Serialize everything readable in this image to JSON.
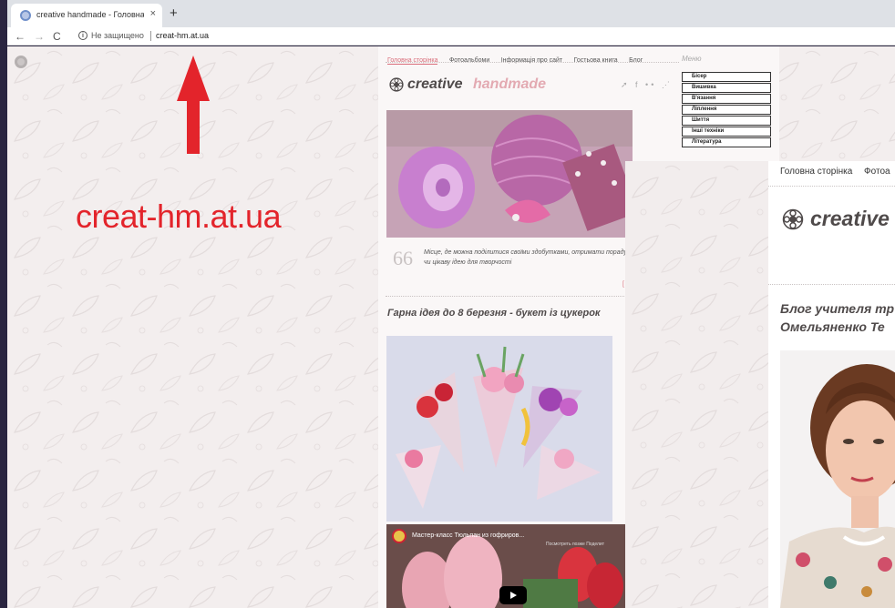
{
  "browser": {
    "tab_title": "creative handmade - Головна сторінка",
    "tab_close": "×",
    "new_tab": "+",
    "nav_back": "←",
    "nav_forward": "→",
    "nav_reload": "C",
    "security_icon": "i",
    "security_label": "Не защищено",
    "url": "creat-hm.at.ua"
  },
  "annotation": {
    "caption": "creat-hm.at.ua",
    "arrow_color": "#e3242b"
  },
  "site_small": {
    "nav": [
      "Головна сторінка",
      "Фотоальбоми",
      "Інформація про сайт",
      "Гостьова книга",
      "Блог"
    ],
    "logo_part1": "creative",
    "logo_part2": "handmade",
    "social_icons": "➚ f •• ⋰",
    "quote_mark": "66",
    "quote": "Місце, де можна поділитися своїми здобутками, отримати пораду чи цікаву ідею для творчості",
    "more_link": "[ Де",
    "post_title": "Гарна ідея до 8 березня - букет із цукерок",
    "video_title": "Мастер-класс Тюльпан из гофриров...",
    "video_sub": "Посмотреть позже    Поделит",
    "menu_title": "Меню",
    "menu_items": [
      "Бісер",
      "Вишивка",
      "В'язання",
      "Ліплення",
      "Шиття",
      "Інші техніки",
      "Література"
    ]
  },
  "site_zoom": {
    "nav": [
      "Головна сторінка",
      "Фотоа"
    ],
    "logo": "creative",
    "title_line1": "Блог учителя тр",
    "title_line2": "Омельяненко Те"
  },
  "colors": {
    "accent_pink": "#d96d7a",
    "logo_pink": "#e3aab2",
    "logo_dark": "#4f4a4a",
    "background": "#f3eeee"
  }
}
